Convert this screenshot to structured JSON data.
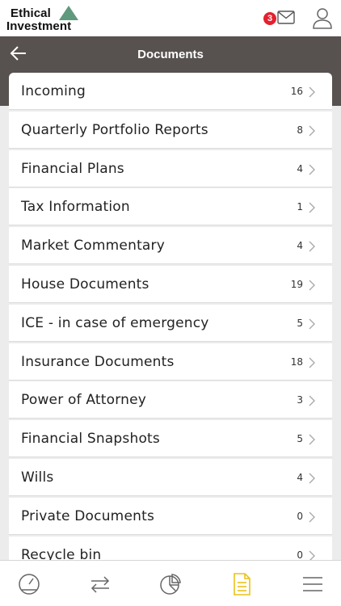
{
  "brand": {
    "line1": "Ethical",
    "line2": "Investment"
  },
  "topbar": {
    "unread_count": "3",
    "mail_icon": "envelope-icon",
    "user_icon": "user-icon"
  },
  "header": {
    "title": "Documents",
    "back_icon": "arrow-left-icon"
  },
  "folders": [
    {
      "label": "Incoming",
      "count": "16"
    },
    {
      "label": "Quarterly Portfolio Reports",
      "count": "8"
    },
    {
      "label": "Financial Plans",
      "count": "4"
    },
    {
      "label": "Tax Information",
      "count": "1"
    },
    {
      "label": "Market Commentary",
      "count": "4"
    },
    {
      "label": "House Documents",
      "count": "19"
    },
    {
      "label": "ICE - in case of emergency",
      "count": "5"
    },
    {
      "label": "Insurance Documents",
      "count": "18"
    },
    {
      "label": "Power of Attorney",
      "count": "3"
    },
    {
      "label": "Financial Snapshots",
      "count": "5"
    },
    {
      "label": "Wills",
      "count": "4"
    },
    {
      "label": "Private Documents",
      "count": "0"
    },
    {
      "label": "Recycle bin",
      "count": "0"
    }
  ],
  "bottom_nav": [
    {
      "icon": "dashboard-gauge-icon",
      "active": false
    },
    {
      "icon": "transfer-arrows-icon",
      "active": false
    },
    {
      "icon": "pie-chart-icon",
      "active": false
    },
    {
      "icon": "document-icon",
      "active": true
    },
    {
      "icon": "menu-icon",
      "active": false
    }
  ],
  "colors": {
    "header_bg": "#57514f",
    "accent": "#e9c21b",
    "badge": "#e5202e",
    "logo_triangle": "#5f9a7e"
  }
}
